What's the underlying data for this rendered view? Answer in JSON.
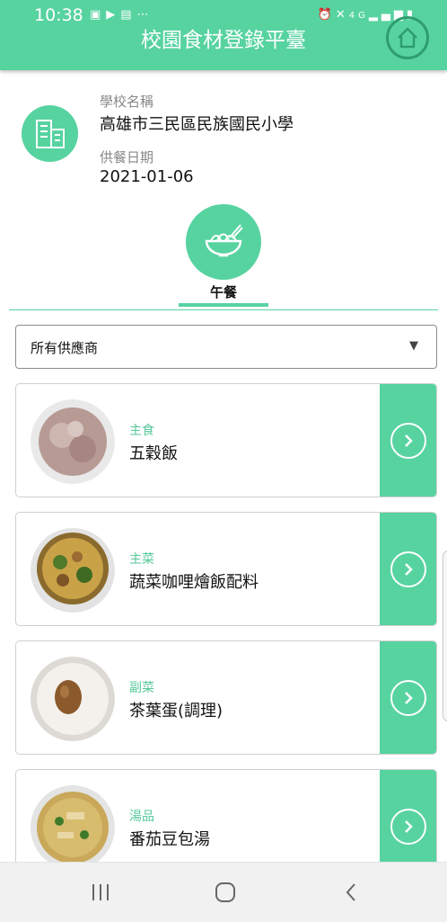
{
  "status_bar": {
    "time": "10:38",
    "left_icons": [
      "image-icon",
      "youtube-icon",
      "file-icon",
      "more-dots-icon"
    ],
    "dots": "⋯",
    "network": "4G"
  },
  "header": {
    "title": "校園食材登錄平臺",
    "home_icon": "home-icon",
    "color": "#57d3a0"
  },
  "school": {
    "icon": "building-icon",
    "name_label": "學校名稱",
    "name": "高雄市三民區民族國民小學",
    "date_label": "供餐日期",
    "date": "2021-01-06"
  },
  "meal": {
    "icon": "noodle-bowl-icon",
    "label": "午餐"
  },
  "supplier_select": {
    "value": "所有供應商",
    "arrow": "▼"
  },
  "dishes": [
    {
      "category": "主食",
      "name": "五穀飯",
      "photo": "rice-photo"
    },
    {
      "category": "主菜",
      "name": "蔬菜咖哩燴飯配料",
      "photo": "curry-photo"
    },
    {
      "category": "副菜",
      "name": "茶葉蛋(調理)",
      "photo": "egg-photo"
    },
    {
      "category": "湯品",
      "name": "番茄豆包湯",
      "photo": "soup-photo"
    }
  ],
  "accent_color": "#57d3a0",
  "nav_bar": {
    "recent_icon": "recent-apps-icon",
    "home_icon": "home-circle-icon",
    "back_icon": "back-icon"
  }
}
